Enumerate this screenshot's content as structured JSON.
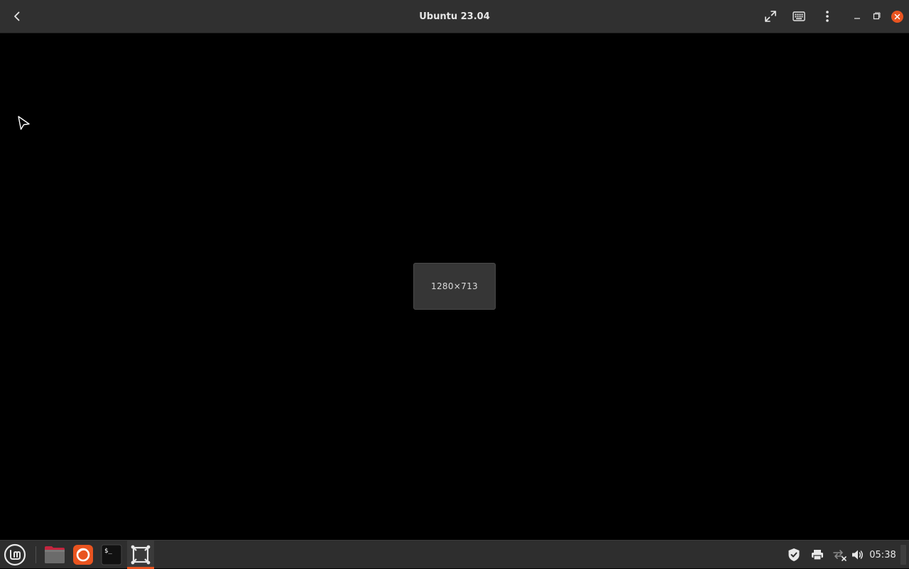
{
  "window": {
    "title": "Ubuntu 23.04"
  },
  "viewer": {
    "resize_label": "1280×713"
  },
  "header_buttons": {
    "back": "back-icon",
    "fullscreen": "fullscreen-icon",
    "keyboard": "keyboard-icon",
    "menu": "kebab-menu-icon",
    "minimize": "minimize-icon",
    "maximize": "maximize-icon",
    "close": "close-icon"
  },
  "taskbar": {
    "launchers": [
      {
        "name": "mint-menu",
        "icon": "linux-mint-logo-icon"
      },
      {
        "name": "files",
        "icon": "folder-icon"
      },
      {
        "name": "firefox",
        "icon": "firefox-icon"
      },
      {
        "name": "terminal",
        "icon": "terminal-icon",
        "glyph": "$_"
      },
      {
        "name": "remote-viewer",
        "icon": "remote-desktop-icon",
        "active": true
      }
    ],
    "tray": [
      {
        "name": "shield",
        "icon": "shield-check-icon"
      },
      {
        "name": "printer",
        "icon": "printer-icon"
      },
      {
        "name": "network",
        "icon": "network-disconnected-icon"
      },
      {
        "name": "volume",
        "icon": "volume-icon"
      }
    ],
    "clock": "05:38"
  },
  "colors": {
    "accent": "#e95420",
    "header_bg": "#303030",
    "panel_bg": "#2e2e2e"
  }
}
